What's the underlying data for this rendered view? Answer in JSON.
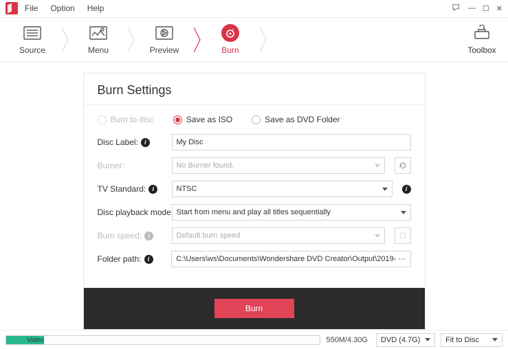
{
  "menu": {
    "file": "File",
    "option": "Option",
    "help": "Help"
  },
  "tabs": {
    "source": "Source",
    "menu": "Menu",
    "preview": "Preview",
    "burn": "Burn",
    "toolbox": "Toolbox"
  },
  "panel": {
    "title": "Burn Settings",
    "radios": {
      "burnToDisc": "Burn to disc",
      "saveIso": "Save as ISO",
      "saveFolder": "Save as DVD Folder"
    },
    "discLabel": {
      "label": "Disc Label:",
      "value": "My Disc"
    },
    "burner": {
      "label": "Burner:",
      "value": "No Burner found."
    },
    "tvStandard": {
      "label": "TV Standard:",
      "value": "NTSC"
    },
    "playbackMode": {
      "label": "Disc playback mode:",
      "value": "Start from menu and play all titles sequentially"
    },
    "burnSpeed": {
      "label": "Burn speed:",
      "value": "Default burn speed"
    },
    "folderPath": {
      "label": "Folder path:",
      "value": "C:\\Users\\ws\\Documents\\Wondershare DVD Creator\\Output\\2019-  ···"
    },
    "burnButton": "Burn"
  },
  "status": {
    "videoLabel": "Video",
    "size": "550M/4.30G",
    "dvdType": "DVD (4.7G)",
    "fit": "Fit to Disc"
  }
}
